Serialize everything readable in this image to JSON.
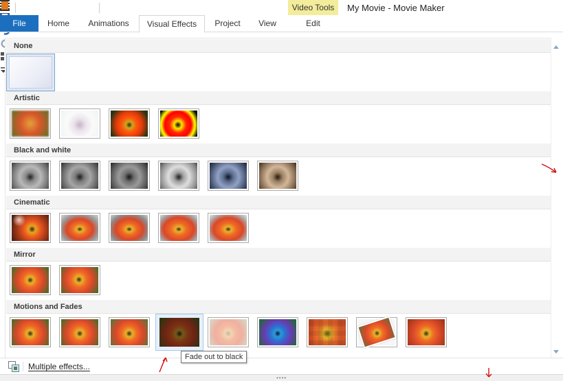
{
  "window": {
    "title": "My Movie - Movie Maker"
  },
  "contextual_group": {
    "label": "Video Tools",
    "tab": "Edit"
  },
  "tabs": [
    {
      "label": "File"
    },
    {
      "label": "Home"
    },
    {
      "label": "Animations"
    },
    {
      "label": "Visual Effects"
    },
    {
      "label": "Project"
    },
    {
      "label": "View"
    }
  ],
  "gallery": {
    "sections": [
      {
        "title": "None"
      },
      {
        "title": "Artistic"
      },
      {
        "title": "Black and white"
      },
      {
        "title": "Cinematic"
      },
      {
        "title": "Mirror"
      },
      {
        "title": "Motions and Fades"
      }
    ]
  },
  "tooltip": "Fade out to black",
  "footer": {
    "multiple_effects": "Multiple effects..."
  }
}
